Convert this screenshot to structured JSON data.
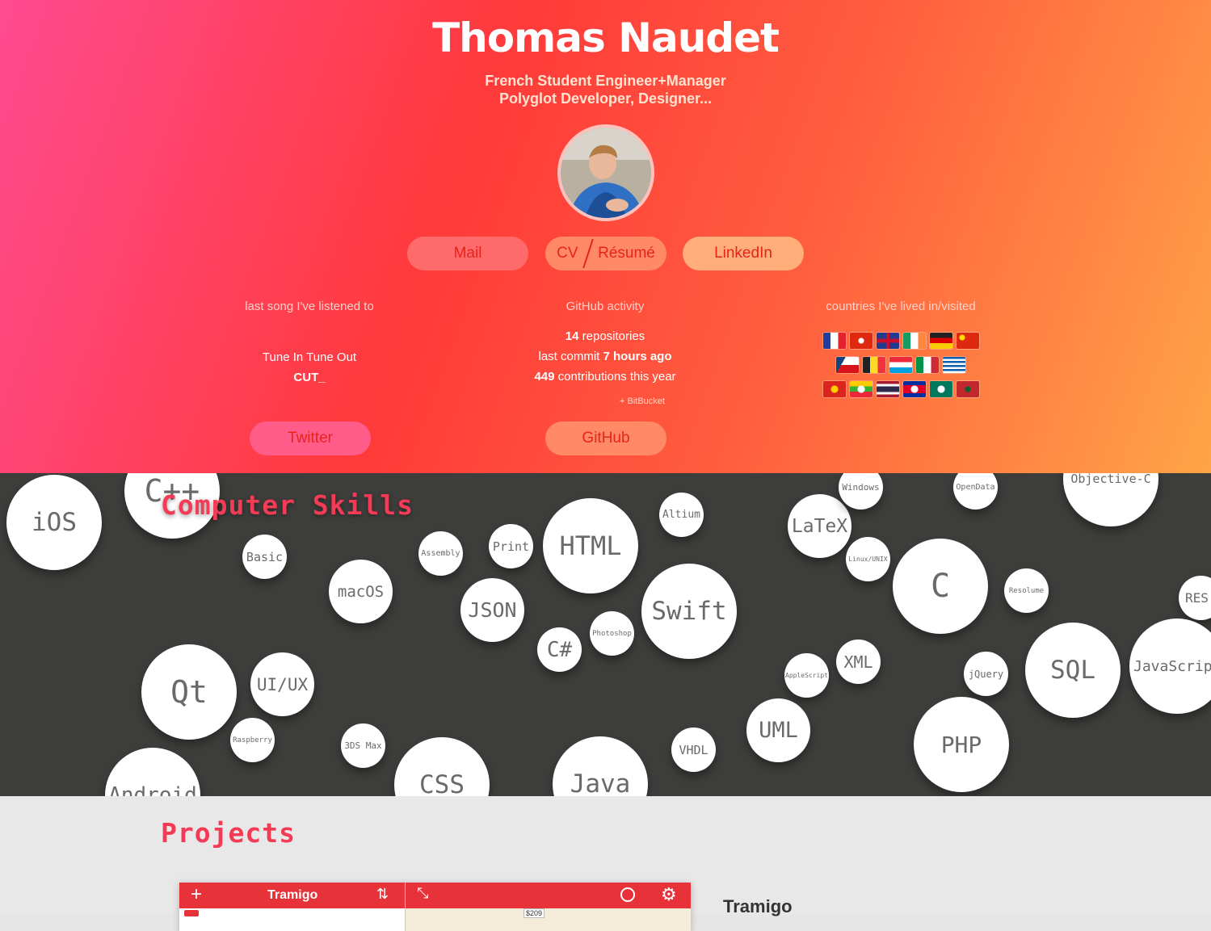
{
  "header": {
    "name": "Thomas Naudet",
    "tagline_1": "French Student Engineer+Manager",
    "tagline_2": "Polyglot Developer, Designer...",
    "avatar_alt": "profile-photo"
  },
  "links": {
    "mail": "Mail",
    "cv_left": "CV",
    "cv_right": "Résumé",
    "linkedin": "LinkedIn",
    "twitter": "Twitter",
    "github": "GitHub"
  },
  "music": {
    "title": "last song I've listened to",
    "song": "Tune In Tune Out",
    "artist": "CUT_"
  },
  "github": {
    "title": "GitHub activity",
    "repos_count": "14",
    "repos_label": " repositories",
    "commit_prefix": "last commit ",
    "commit_time": "7 hours ago",
    "contrib_count": "449",
    "contrib_label": " contributions this year",
    "bitbucket": "+ BitBucket"
  },
  "countries": {
    "title": "countries I've lived in/visited",
    "flags": [
      [
        "france",
        "hong-kong",
        "united-kingdom",
        "ireland",
        "germany",
        "china"
      ],
      [
        "czechia",
        "belgium",
        "luxembourg",
        "italy",
        "greece"
      ],
      [
        "vietnam",
        "myanmar",
        "thailand",
        "cambodia",
        "macau",
        "morocco"
      ]
    ]
  },
  "skills": {
    "title": "Computer Skills",
    "items": [
      "iOS",
      "C++",
      "Basic",
      "macOS",
      "Assembly",
      "Print",
      "JSON",
      "HTML",
      "Altium",
      "Swift",
      "Photoshop",
      "C#",
      "Qt",
      "UI/UX",
      "Raspberry",
      "3DS Max",
      "CSS",
      "Android",
      "Java",
      "VHDL",
      "UML",
      "LaTeX",
      "Windows",
      "Linux/UNIX",
      "AppleScript",
      "XML",
      "C",
      "OpenData",
      "Objective-C",
      "Resolume",
      "jQuery",
      "SQL",
      "PHP",
      "RES",
      "JavaScript"
    ]
  },
  "projects": {
    "title": "Projects",
    "app_title": "Tramigo",
    "app_price": "$209",
    "project_name": "Tramigo"
  },
  "colors": {
    "accent": "#f43b56",
    "skills_bg": "#3d3d3b",
    "app_bar": "#e8323a"
  }
}
